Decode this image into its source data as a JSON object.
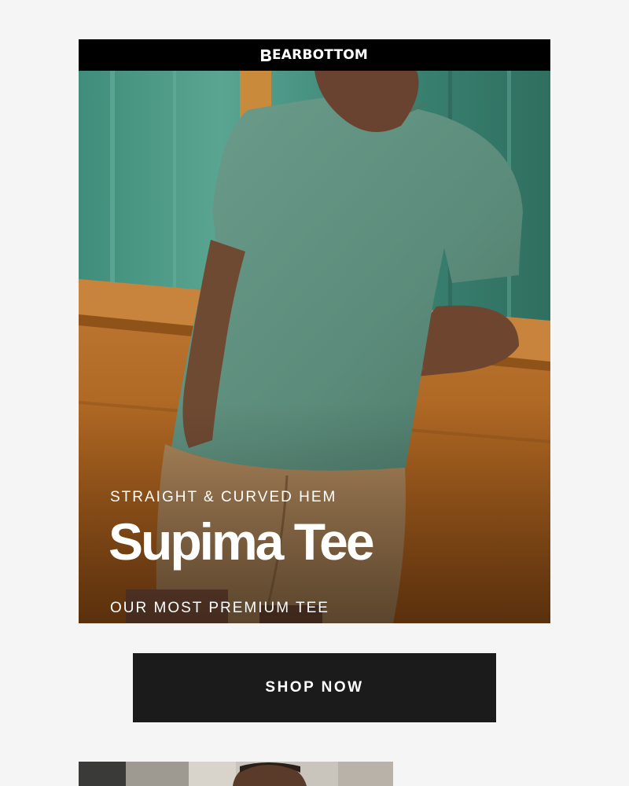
{
  "brand": {
    "name": "EARBOTTOM",
    "logo_mark": "bear-b-mark"
  },
  "hero": {
    "eyebrow": "STRAIGHT & CURVED HEM",
    "title": "Supima Tee",
    "subtitle": "OUR MOST PREMIUM TEE",
    "image": "man-in-green-tee-leaning-on-wood-wall"
  },
  "cta": {
    "label": "SHOP NOW"
  },
  "colors": {
    "topbar": "#000000",
    "button": "#1b1b1b",
    "page_bg": "#f5f5f5",
    "tee_green": "#5f8f7e",
    "wood": "#b8702a"
  },
  "teaser": {
    "image": "next-product-photo-man-portrait"
  }
}
